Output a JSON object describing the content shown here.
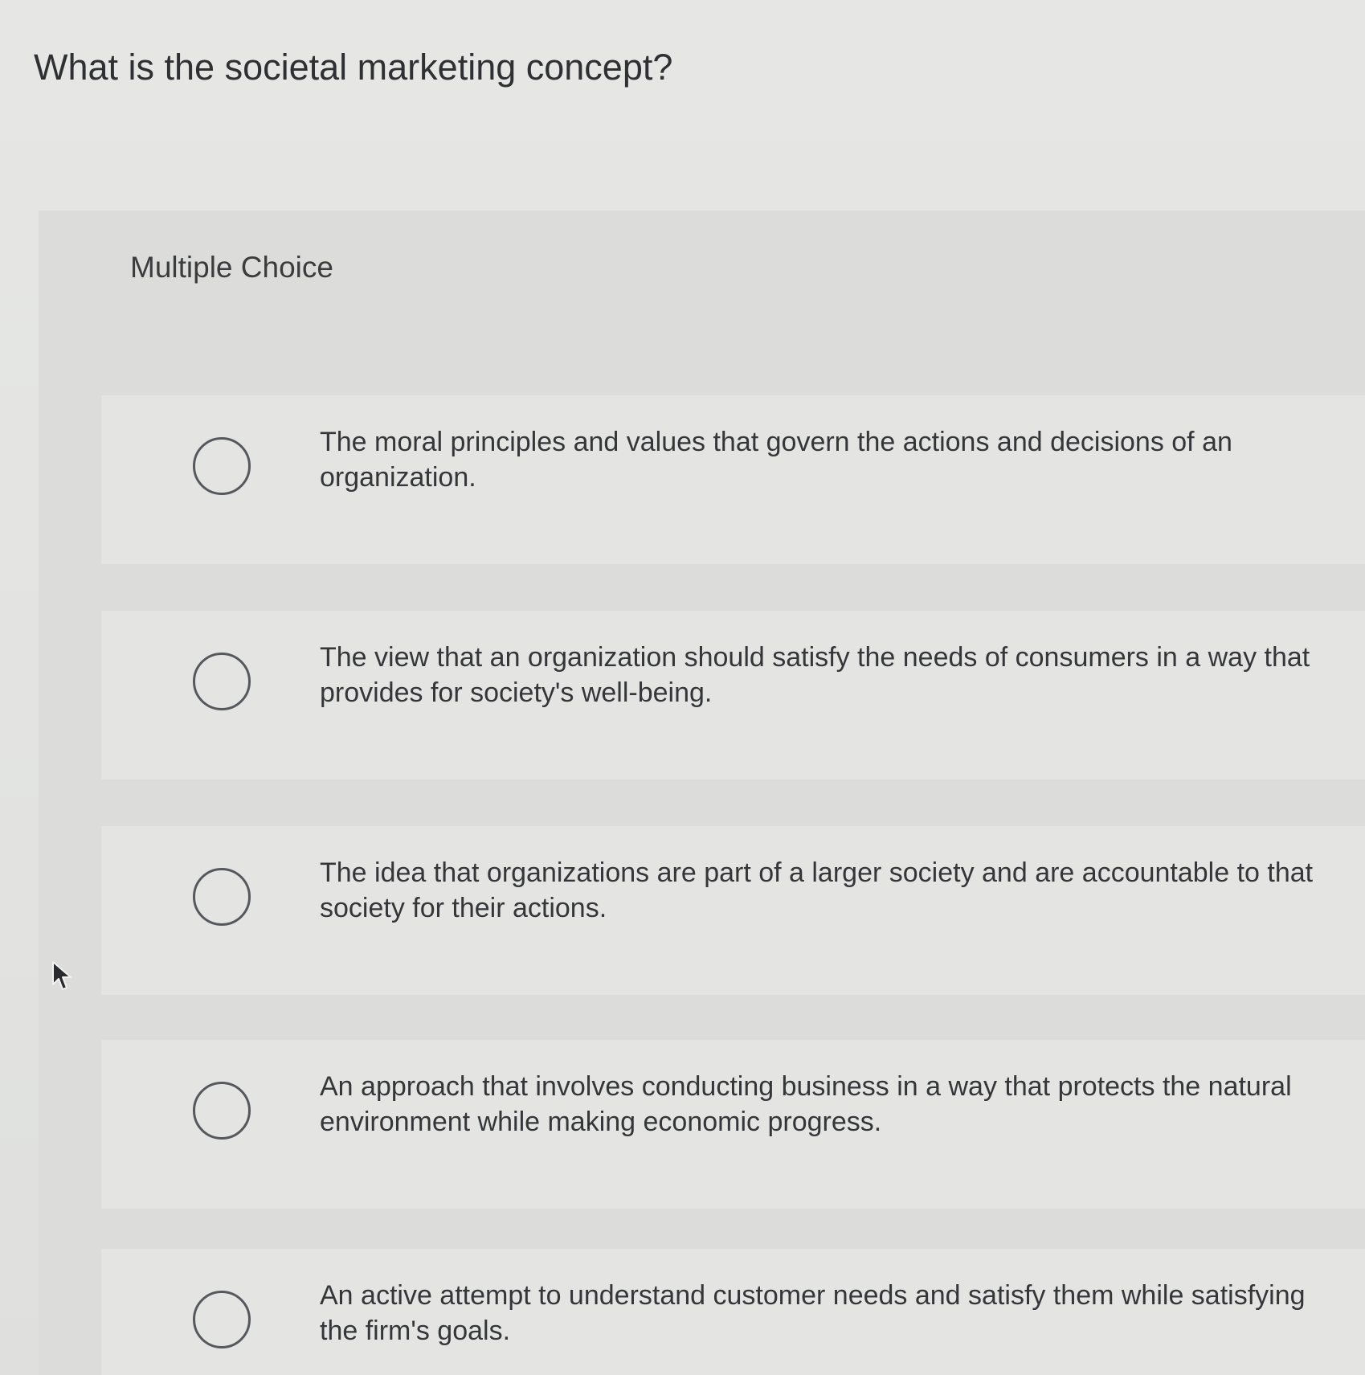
{
  "question": {
    "text": "What is the societal marketing concept?"
  },
  "question_type": "Multiple Choice",
  "options": [
    {
      "text": "The moral principles and values that govern the actions and decisions of an organization."
    },
    {
      "text": "The view that an organization should satisfy the needs of consumers in a way that provides for society's well-being."
    },
    {
      "text": "The idea that organizations are part of a larger society and are accountable to that society for their actions."
    },
    {
      "text": "An approach that involves conducting business in a way that protects the natural environment while making economic progress."
    },
    {
      "text": "An active attempt to understand customer needs and satisfy them while satisfying the firm's goals."
    }
  ],
  "icons": {
    "radio": "radio-unselected-icon",
    "cursor": "mouse-pointer-icon"
  }
}
